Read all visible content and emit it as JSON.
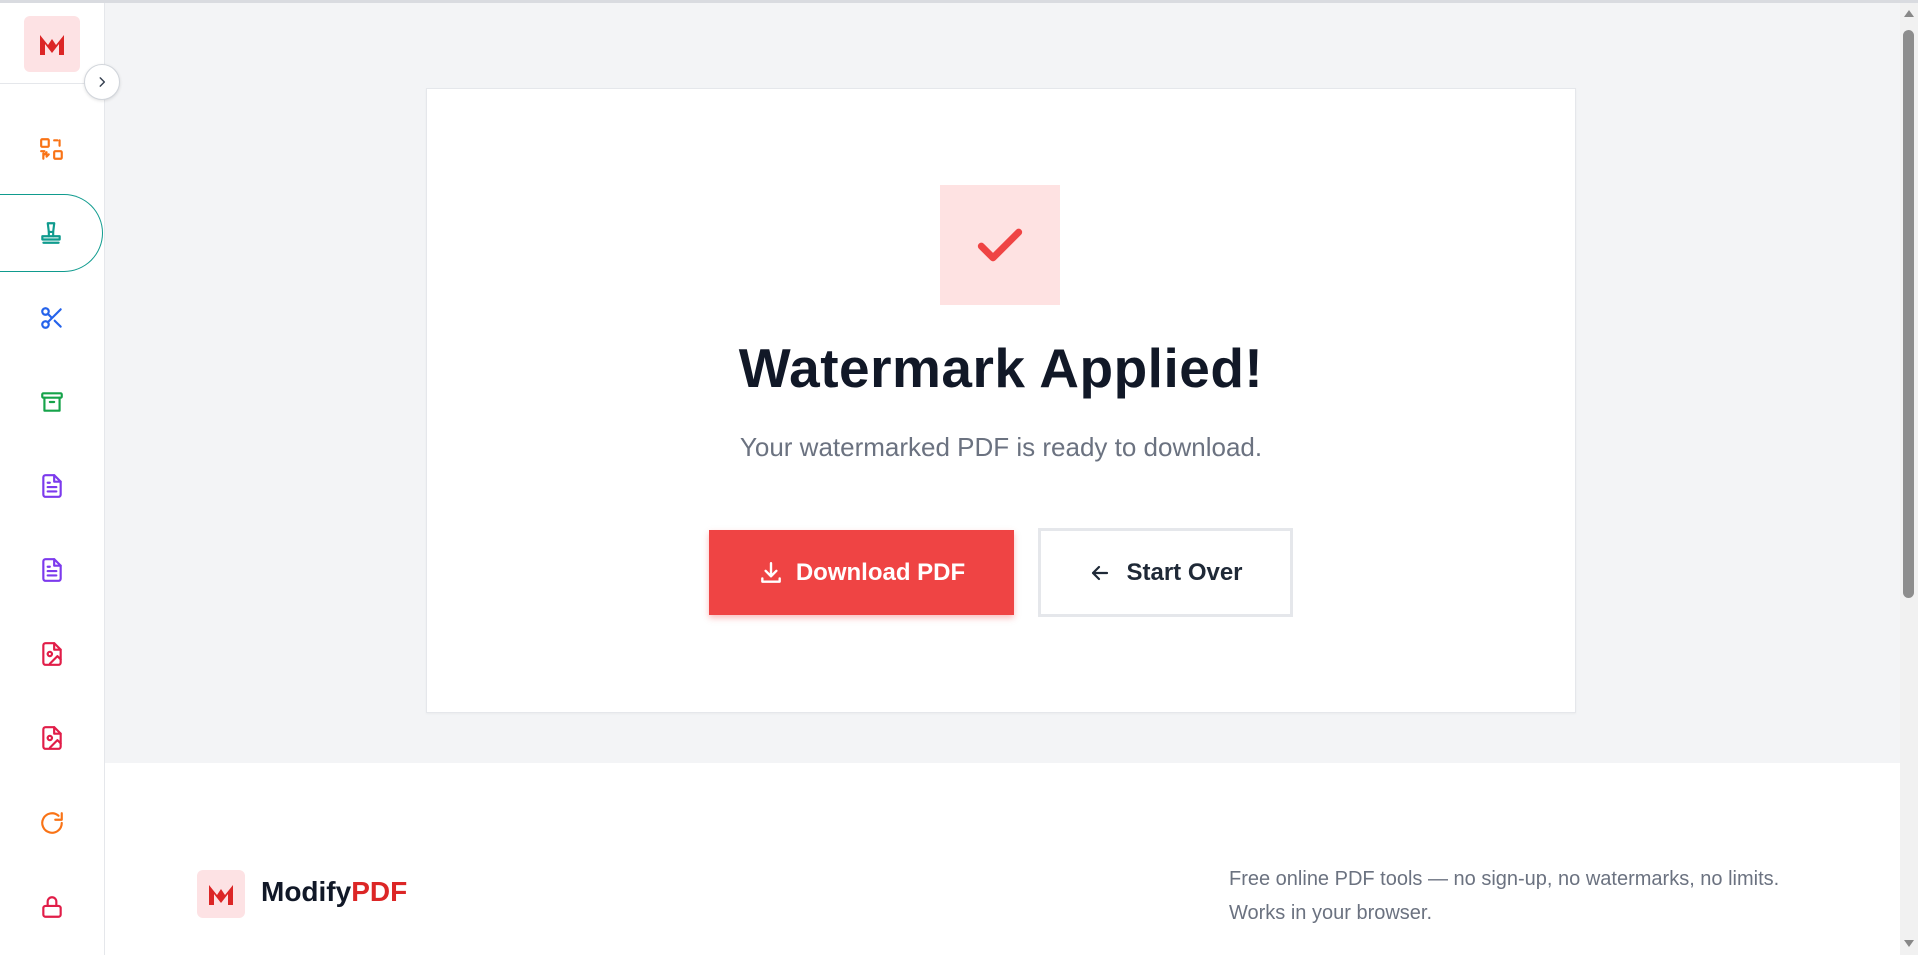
{
  "app": {
    "brand_main": "Modify",
    "brand_accent": "PDF",
    "brand_color": "#dc2626"
  },
  "sidebar": {
    "toggle_icon": "chevron-right-icon",
    "items": [
      {
        "name": "organize",
        "icon": "arrange-icon",
        "color": "#f97316"
      },
      {
        "name": "watermark",
        "icon": "stamp-icon",
        "color": "#0f9b8e",
        "active": true
      },
      {
        "name": "split",
        "icon": "scissors-icon",
        "color": "#2563eb"
      },
      {
        "name": "compress",
        "icon": "archive-icon",
        "color": "#16a34a"
      },
      {
        "name": "document-1",
        "icon": "document-icon",
        "color": "#7c3aed"
      },
      {
        "name": "document-2",
        "icon": "document-icon",
        "color": "#7c3aed"
      },
      {
        "name": "image-1",
        "icon": "image-file-icon",
        "color": "#e11d48"
      },
      {
        "name": "image-2",
        "icon": "image-file-icon",
        "color": "#e11d48"
      },
      {
        "name": "rotate",
        "icon": "rotate-icon",
        "color": "#f97316"
      },
      {
        "name": "protect",
        "icon": "lock-icon",
        "color": "#e11d48"
      }
    ]
  },
  "result": {
    "icon": "check-icon",
    "title": "Watermark Applied!",
    "subtitle": "Your watermarked PDF is ready to download.",
    "download_label": "Download PDF",
    "start_over_label": "Start Over"
  },
  "footer": {
    "tagline_line1": "Free online PDF tools — no sign-up, no watermarks, no limits.",
    "tagline_line2": "Works in your browser."
  }
}
